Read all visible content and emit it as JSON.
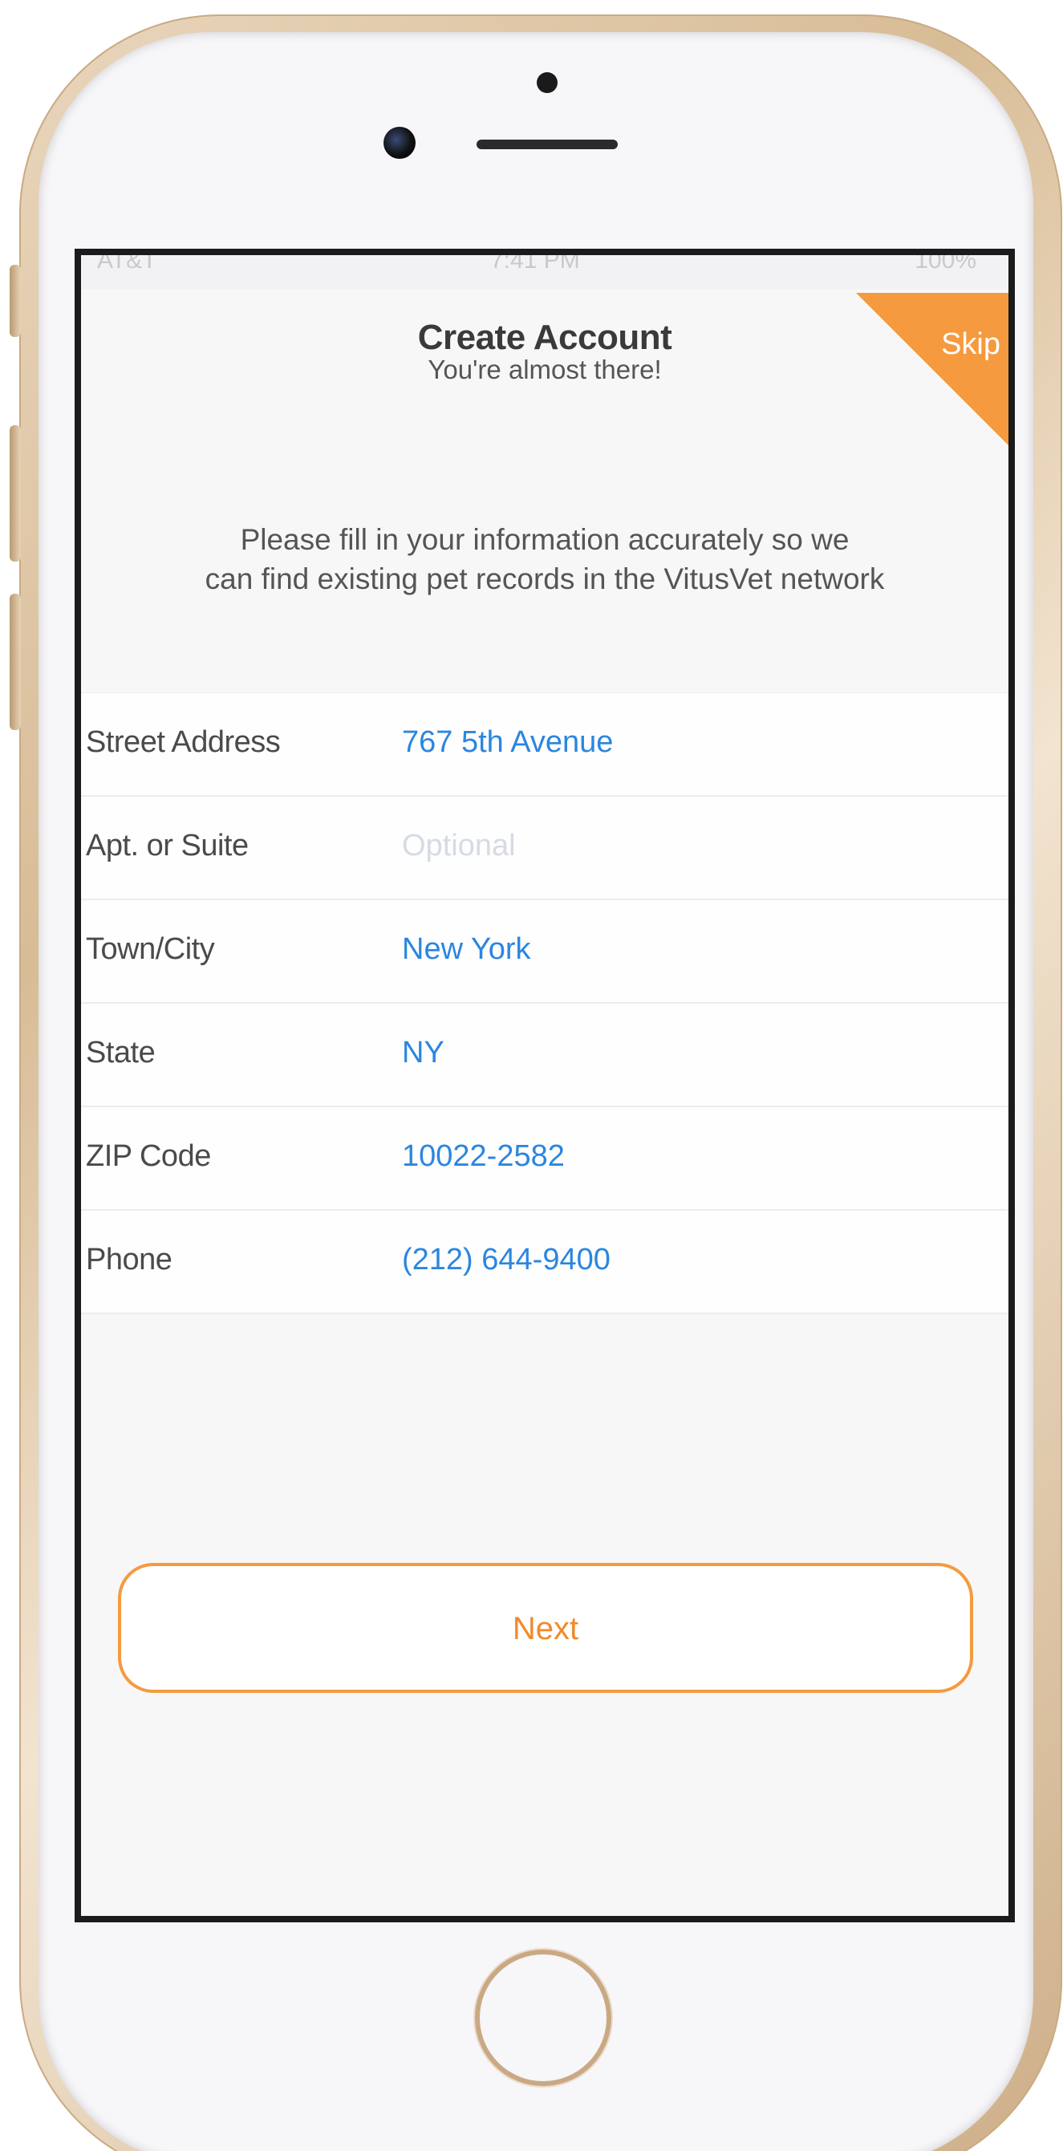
{
  "status_bar": {
    "carrier": "AT&T",
    "time": "7:41 PM",
    "battery": "100%"
  },
  "header": {
    "title": "Create Account",
    "subtitle": "You're almost there!",
    "skip_label": "Skip"
  },
  "intro": {
    "line1": "Please fill in your information accurately so we",
    "line2": "can find existing pet records in the VitusVet network"
  },
  "form": {
    "street": {
      "label": "Street Address",
      "value": "767 5th Avenue"
    },
    "apt": {
      "label": "Apt. or Suite",
      "value": "",
      "placeholder": "Optional"
    },
    "city": {
      "label": "Town/City",
      "value": "New York"
    },
    "state": {
      "label": "State",
      "value": "NY"
    },
    "zip": {
      "label": "ZIP Code",
      "value": "10022-2582"
    },
    "phone": {
      "label": "Phone",
      "value": "(212) 644-9400"
    }
  },
  "actions": {
    "next_label": "Next"
  },
  "colors": {
    "accent": "#f59a3f",
    "value_blue": "#2b86e0"
  }
}
